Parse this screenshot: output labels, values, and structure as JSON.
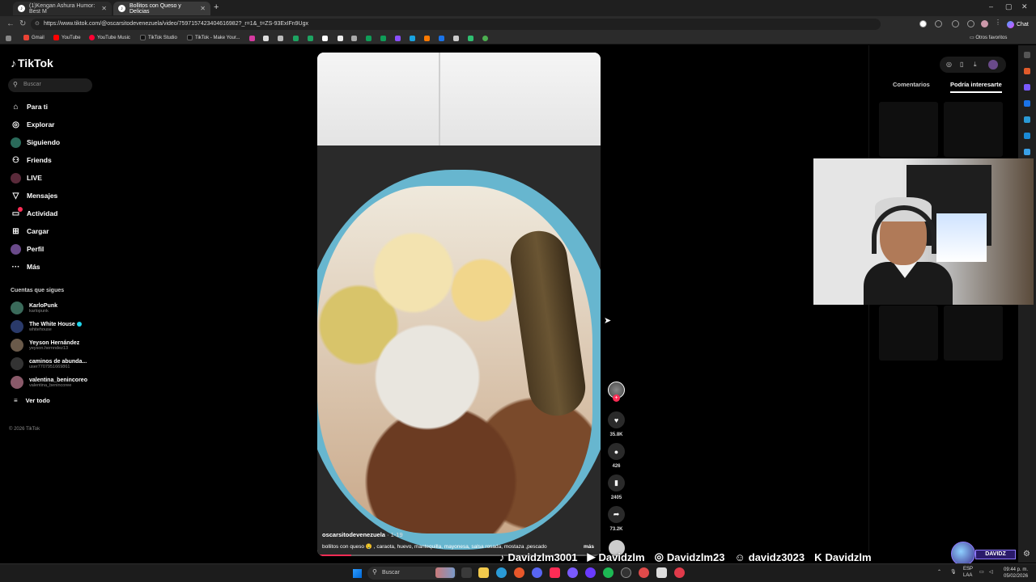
{
  "browser": {
    "tabs": [
      {
        "title": "(1)Kengan Ashura Humor: Best M",
        "icon": "tiktok-icon"
      },
      {
        "title": "Bollitos con Queso y Delicias",
        "icon": "tiktok-icon",
        "active": true
      }
    ],
    "new_tab": "+",
    "url": "https://www.tiktok.com/@oscarsitodevenezuela/video/7597157423404616982?_r=1&_t=ZS-93ExIFn9Ugx",
    "chat_label": "Chat",
    "bookmarks": [
      "Gmail",
      "YouTube",
      "YouTube Music",
      "TikTok Studio",
      "TikTok - Make Your..."
    ],
    "other_favorites": "Otros favoritos"
  },
  "tiktok": {
    "logo": "TikTok",
    "search_placeholder": "Buscar",
    "menu": [
      {
        "label": "Para ti",
        "icon": "home-icon"
      },
      {
        "label": "Explorar",
        "icon": "compass-icon"
      },
      {
        "label": "Siguiendo",
        "icon": "following-icon"
      },
      {
        "label": "Friends",
        "icon": "friends-icon"
      },
      {
        "label": "LIVE",
        "icon": "live-icon"
      },
      {
        "label": "Mensajes",
        "icon": "messages-icon"
      },
      {
        "label": "Actividad",
        "icon": "activity-icon"
      },
      {
        "label": "Cargar",
        "icon": "upload-icon"
      },
      {
        "label": "Perfil",
        "icon": "profile-icon"
      },
      {
        "label": "Más",
        "icon": "more-icon"
      }
    ],
    "following_heading": "Cuentas que sigues",
    "following": [
      {
        "name": "KarloPunk",
        "handle": "karlopunk",
        "color": "#3a6a5a"
      },
      {
        "name": "The White House",
        "handle": "whitehouse",
        "verified": true,
        "color": "#2a3a6a"
      },
      {
        "name": "Yeyson Hernández",
        "handle": "yeyson.hernndez13",
        "color": "#6a5a4a"
      },
      {
        "name": "caminos de abunda...",
        "handle": "user7707951669861",
        "color": "#333333"
      },
      {
        "name": "valentina_benincoreo",
        "handle": "valentina_benincoree",
        "color": "#8a5a6a"
      }
    ],
    "see_all": "Ver todo",
    "copyright": "© 2026 TikTok",
    "video": {
      "author": "oscarsitodevenezuela",
      "date": "· 1-19",
      "description": "bollitos con queso 🤤 , caraota, huevo, mantequilla, mayonesa, salsa rosada, mostaza ,pescado",
      "more": "más",
      "progress": 0.12
    },
    "actions": {
      "likes": "35.8K",
      "comments": "426",
      "saves": "2405",
      "shares": "73.2K"
    },
    "right_panel": {
      "tabs": [
        "Comentarios",
        "Podría interesarte"
      ],
      "active_tab": 1
    }
  },
  "overlay": {
    "socials": [
      {
        "icon": "tiktok-icon",
        "text": "Davidzlm3001"
      },
      {
        "icon": "youtube-icon",
        "text": "Davidzlm"
      },
      {
        "icon": "instagram-icon",
        "text": "Davidzlm23"
      },
      {
        "icon": "discord-icon",
        "text": "davidz3023"
      },
      {
        "icon": "kick-icon",
        "text": "Davidzlm"
      }
    ],
    "logo_text": "DAVIDZ"
  },
  "taskbar": {
    "search_placeholder": "Buscar",
    "language": "ESP",
    "language_sub": "LAA",
    "time": "09:44 p. m.",
    "date": "05/02/2026"
  }
}
